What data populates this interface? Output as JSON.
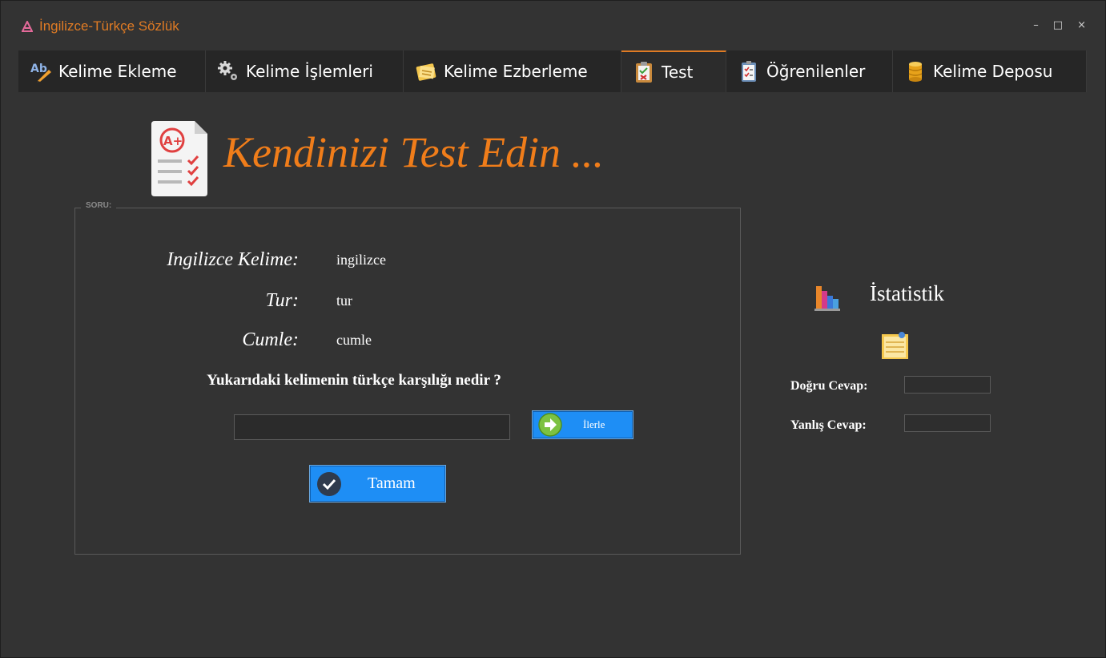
{
  "window": {
    "title": "İngilizce-Türkçe Sözlük",
    "controls": {
      "minimize": "–",
      "maximize": "□",
      "close": "×"
    }
  },
  "tabs": [
    {
      "label": "Kelime Ekleme",
      "icon": "ab-pencil-icon"
    },
    {
      "label": "Kelime İşlemleri",
      "icon": "gears-icon"
    },
    {
      "label": "Kelime Ezberleme",
      "icon": "notes-icon"
    },
    {
      "label": "Test",
      "icon": "clipboard-test-icon",
      "active": true
    },
    {
      "label": "Öğrenilenler",
      "icon": "checklist-icon"
    },
    {
      "label": "Kelime Deposu",
      "icon": "database-icon"
    }
  ],
  "header": {
    "title": "Kendinizi Test Edin ..."
  },
  "question_group": {
    "legend": "SORU:",
    "english_label": "Ingilizce Kelime:",
    "english_value": "ingilizce",
    "type_label": "Tur:",
    "type_value": "tur",
    "sentence_label": "Cumle:",
    "sentence_value": "cumle",
    "prompt": "Yukarıdaki kelimenin türkçe karşılığı nedir ?",
    "answer_value": "",
    "next_button": "İlerle",
    "ok_button": "Tamam"
  },
  "stats": {
    "title": "İstatistik",
    "correct_label": "Doğru Cevap:",
    "correct_value": "",
    "wrong_label": "Yanlış Cevap:",
    "wrong_value": ""
  },
  "colors": {
    "accent": "#f07d1a",
    "background": "#333333",
    "tab_bar": "#262626",
    "button_blue": "#1e8ef5"
  }
}
